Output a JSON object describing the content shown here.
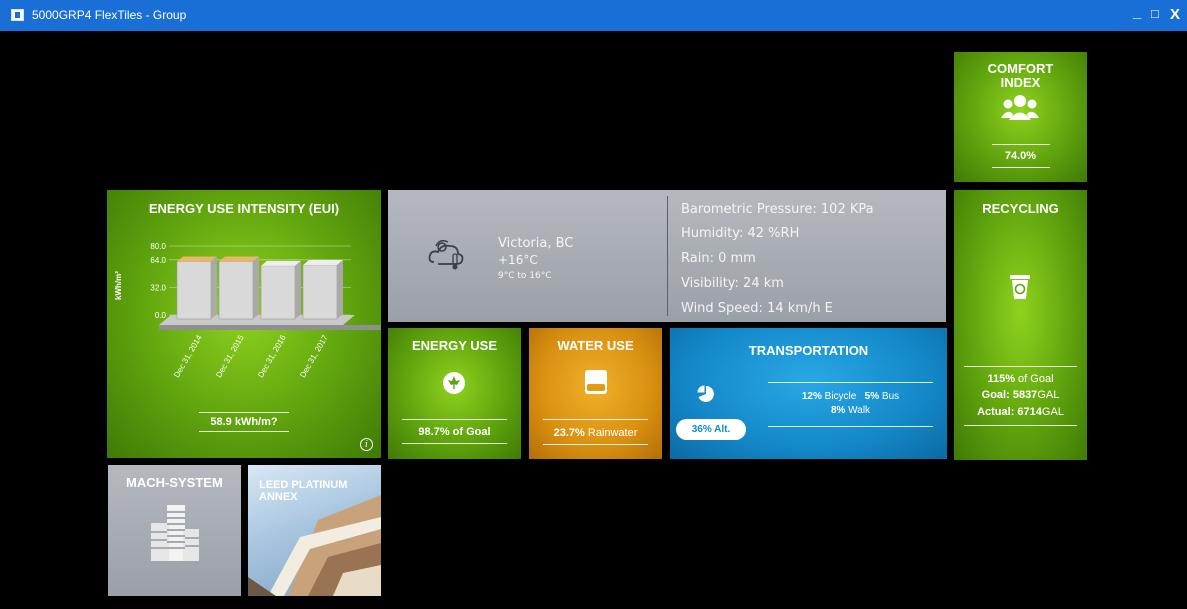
{
  "window": {
    "title": "5000GRP4 FlexTiles - Group",
    "minimize": "_",
    "maximize": "□",
    "close": "X"
  },
  "eui": {
    "title": "ENERGY USE INTENSITY (EUI)",
    "ylabel": "kWh/m²",
    "ticks": [
      "80.0",
      "64.0",
      "32.0",
      "0.0"
    ],
    "value": "58.9 kWh/m?",
    "info": "i"
  },
  "chart_data": {
    "type": "bar",
    "categories": [
      "Dec 31, 2014",
      "Dec 31, 2015",
      "Dec 31, 2016",
      "Dec 31, 2017"
    ],
    "values": [
      62,
      62,
      57,
      58
    ],
    "title": "",
    "ylabel": "kWh/m²",
    "ylim": [
      0,
      80
    ]
  },
  "weather": {
    "city": "Victoria, BC",
    "temp": "+16°C",
    "range": "9°C to 16°C",
    "details": [
      "Barometric Pressure: 102 KPa",
      "Humidity: 42 %RH",
      "Rain: 0 mm",
      "Visibility: 24 km",
      "Wind Speed: 14 km/h E"
    ]
  },
  "comfort": {
    "title1": "COMFORT",
    "title2": "INDEX",
    "value": "74.0%"
  },
  "recycling": {
    "title": "RECYCLING",
    "goal_pct": "115%",
    "goal_suffix": " of Goal",
    "goal_label": "Goal: ",
    "goal_val": "5837",
    "goal_unit": "GAL",
    "actual_label": "Actual: ",
    "actual_val": "6714",
    "actual_unit": "GAL"
  },
  "energy_use": {
    "title": "ENERGY USE",
    "value": "98.7% of Goal"
  },
  "water_use": {
    "title": "WATER USE",
    "pct": "23.7%",
    "suffix": " Rainwater"
  },
  "transport": {
    "title": "TRANSPORTATION",
    "bicycle_pct": "12%",
    "bicycle": " Bicycle",
    "bus_pct": "5%",
    "bus": " Bus",
    "walk_pct": "8%",
    "walk": " Walk",
    "alt": "36% Alt."
  },
  "mach": {
    "title": "MACH-SYSTEM"
  },
  "leed": {
    "title1": "LEED PLATINUM",
    "title2": "ANNEX"
  },
  "colors": {
    "green": "#6cb312",
    "blue": "#1488c9",
    "orange": "#e39a14",
    "gray": "#a6abb1",
    "titlebar": "#1a6fd6"
  }
}
